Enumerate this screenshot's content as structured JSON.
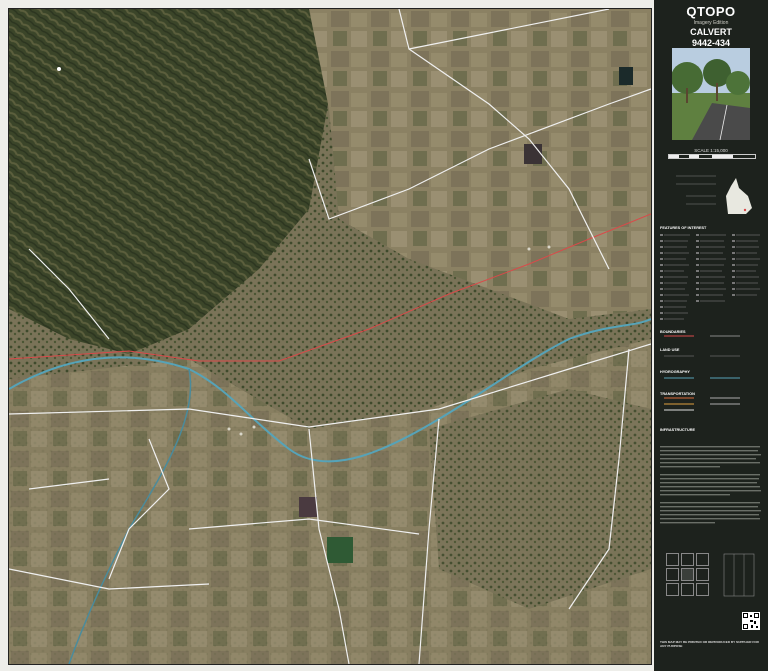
{
  "panel": {
    "brand": "QTOPO",
    "edition": "Imagery Edition",
    "sheet_name": "CALVERT",
    "sheet_number": "9442-434",
    "scale": "SCALE 1:15,000",
    "legend_sections": [
      "FEATURES OF INTEREST",
      "BOUNDARIES",
      "LAND USE",
      "HYDROGRAPHY",
      "TRANSPORTATION",
      "INFRASTRUCTURE"
    ],
    "footer_line": "THIS MAP MAY BE PRINTED OR REPRODUCED BY SUPPLIER FOR ANY PURPOSE"
  },
  "colors": {
    "panel_bg": "#1d221d",
    "terrain_dark": "#3f4a2c",
    "terrain_farm": "#8a7f60",
    "road": "#f0f0f0",
    "boundary": "#d94a4a",
    "water": "#56a3b8"
  },
  "icons": [
    "location-pin-icon",
    "qr-code-icon",
    "queensland-inset-icon"
  ]
}
